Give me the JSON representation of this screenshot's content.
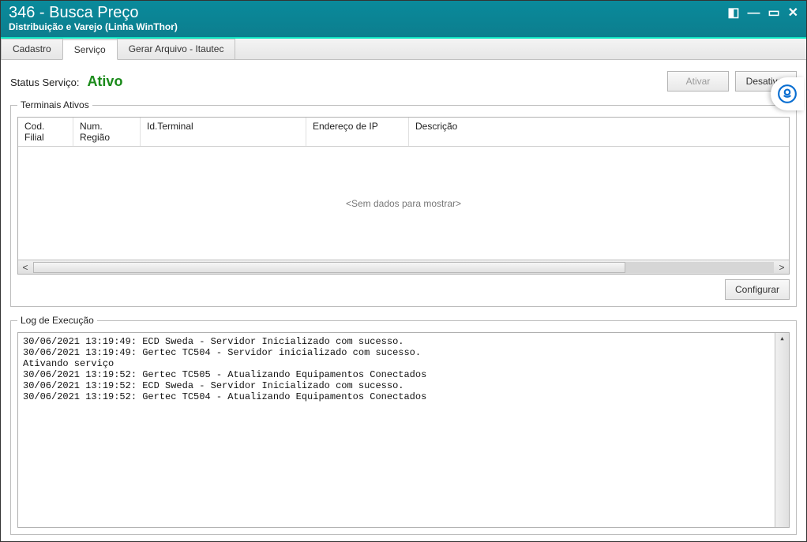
{
  "window": {
    "title": "346 - Busca Preço",
    "subtitle": "Distribuição e Varejo (Linha WinThor)"
  },
  "tabs": {
    "cadastro": "Cadastro",
    "servico": "Serviço",
    "gerar_arquivo": "Gerar Arquivo - Itautec"
  },
  "status": {
    "label": "Status Serviço:",
    "value": "Ativo",
    "btn_ativar": "Ativar",
    "btn_desativar": "Desativar"
  },
  "terminais": {
    "legend": "Terminais Ativos",
    "columns": {
      "c1": "Cod. Filial",
      "c2": "Num. Região",
      "c3": "Id.Terminal",
      "c4": "Endereço de IP",
      "c5": "Descrição"
    },
    "empty": "<Sem dados para mostrar>",
    "btn_configurar": "Configurar"
  },
  "log": {
    "legend": "Log de Execução",
    "lines": {
      "l0": "30/06/2021 13:19:49: ECD Sweda - Servidor Inicializado com sucesso.",
      "l1": "30/06/2021 13:19:49: Gertec TC504 - Servidor inicializado com sucesso.",
      "l2": "Ativando serviço",
      "l3": "30/06/2021 13:19:52: Gertec TC505 - Atualizando Equipamentos Conectados",
      "l4": "30/06/2021 13:19:52: ECD Sweda - Servidor Inicializado com sucesso.",
      "l5": "30/06/2021 13:19:52: Gertec TC504 - Atualizando Equipamentos Conectados"
    }
  }
}
